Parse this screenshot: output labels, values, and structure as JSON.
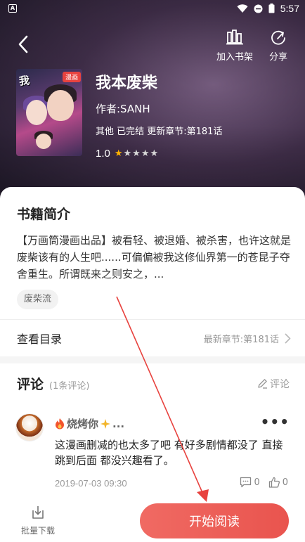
{
  "status_bar": {
    "time": "5:57",
    "app_icon": "A"
  },
  "header": {
    "back_icon": "back-arrow-icon",
    "add_to_shelf_label": "加入书架",
    "share_label": "分享"
  },
  "book": {
    "cover_tag": "漫画",
    "cover_brand": "我本废柴",
    "title": "我本废柴",
    "author": "作者:SANH",
    "meta": "其他 已完结 更新章节:第181话",
    "rating": "1.0",
    "rating_stars": 1,
    "star_count": 5
  },
  "intro": {
    "title": "书籍简介",
    "text": "【万画筒漫画出品】被看轻、被退婚、被杀害，也许这就是废柴该有的人生吧......可偏偏被我这修仙界第一的苍昆子夺舍重生。所谓既来之则安之，...",
    "tag": "废柴流"
  },
  "catalog": {
    "label": "查看目录",
    "latest": "最新章节:第181话"
  },
  "comments": {
    "title": "评论",
    "count": "(1条评论)",
    "write_label": "评论",
    "items": [
      {
        "user": "烧烤你",
        "user_suffix": "...",
        "text": "这漫画删减的也太多了吧 有好多剧情都没了 直接跳到后面 都没兴趣看了。",
        "date": "2019-07-03 09:30",
        "reply_count": "0",
        "like_count": "0"
      }
    ]
  },
  "bottom": {
    "batch_download_label": "批量下载",
    "start_reading_label": "开始阅读"
  },
  "colors": {
    "accent": "#e9544e",
    "star": "#ffb400",
    "annotation_arrow": "#e8433f"
  }
}
